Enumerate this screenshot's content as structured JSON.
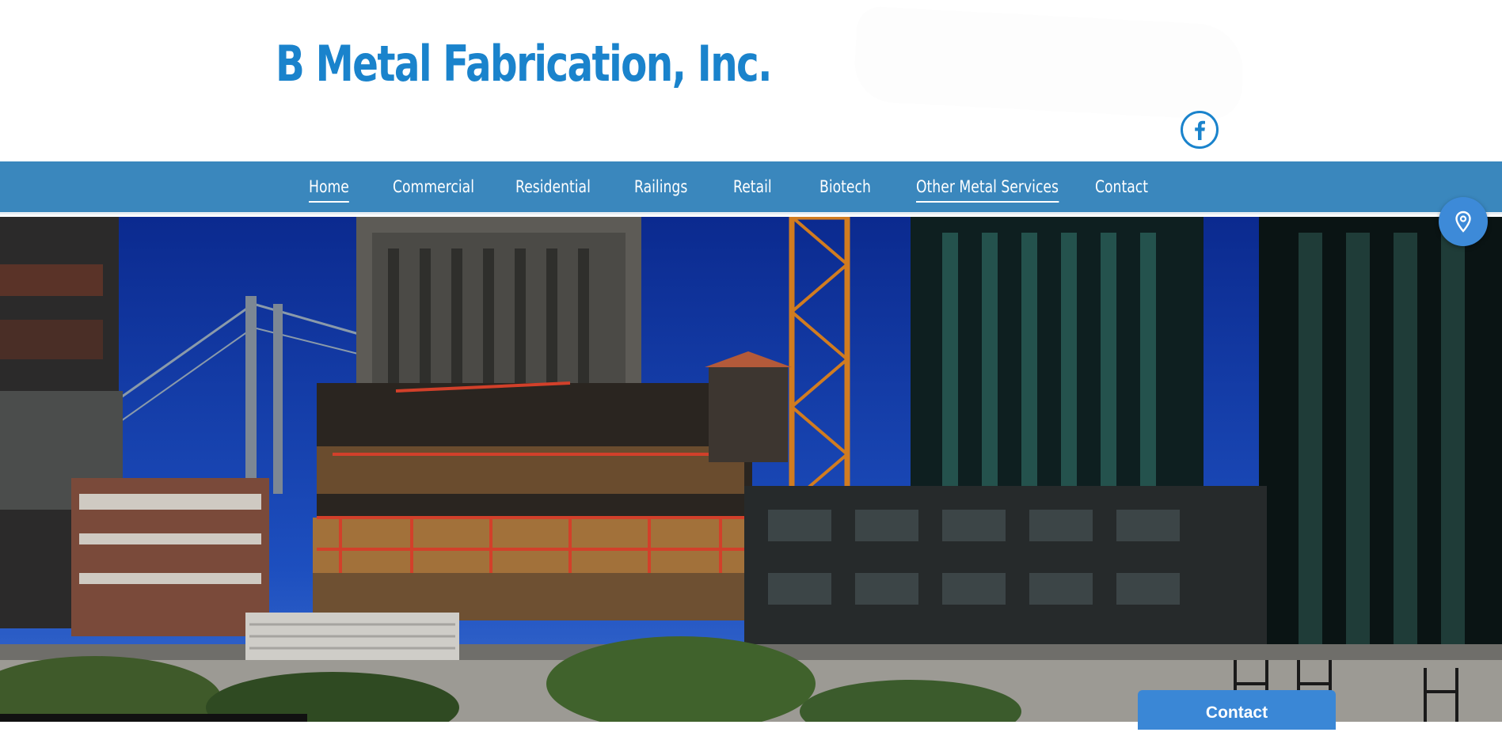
{
  "header": {
    "site_title": "B Metal Fabrication, Inc.",
    "social_icon": "facebook-icon"
  },
  "nav": {
    "items": [
      {
        "label": "Home"
      },
      {
        "label": "Commercial"
      },
      {
        "label": "Residential"
      },
      {
        "label": "Railings"
      },
      {
        "label": "Retail"
      },
      {
        "label": "Biotech"
      },
      {
        "label": "Other Metal Services"
      },
      {
        "label": "Contact"
      }
    ]
  },
  "floating": {
    "map_icon": "map-pin-icon",
    "contact_label": "Contact"
  },
  "colors": {
    "brand": "#1a83cc",
    "nav_bg": "#3a87bd",
    "button": "#3a87d6"
  }
}
